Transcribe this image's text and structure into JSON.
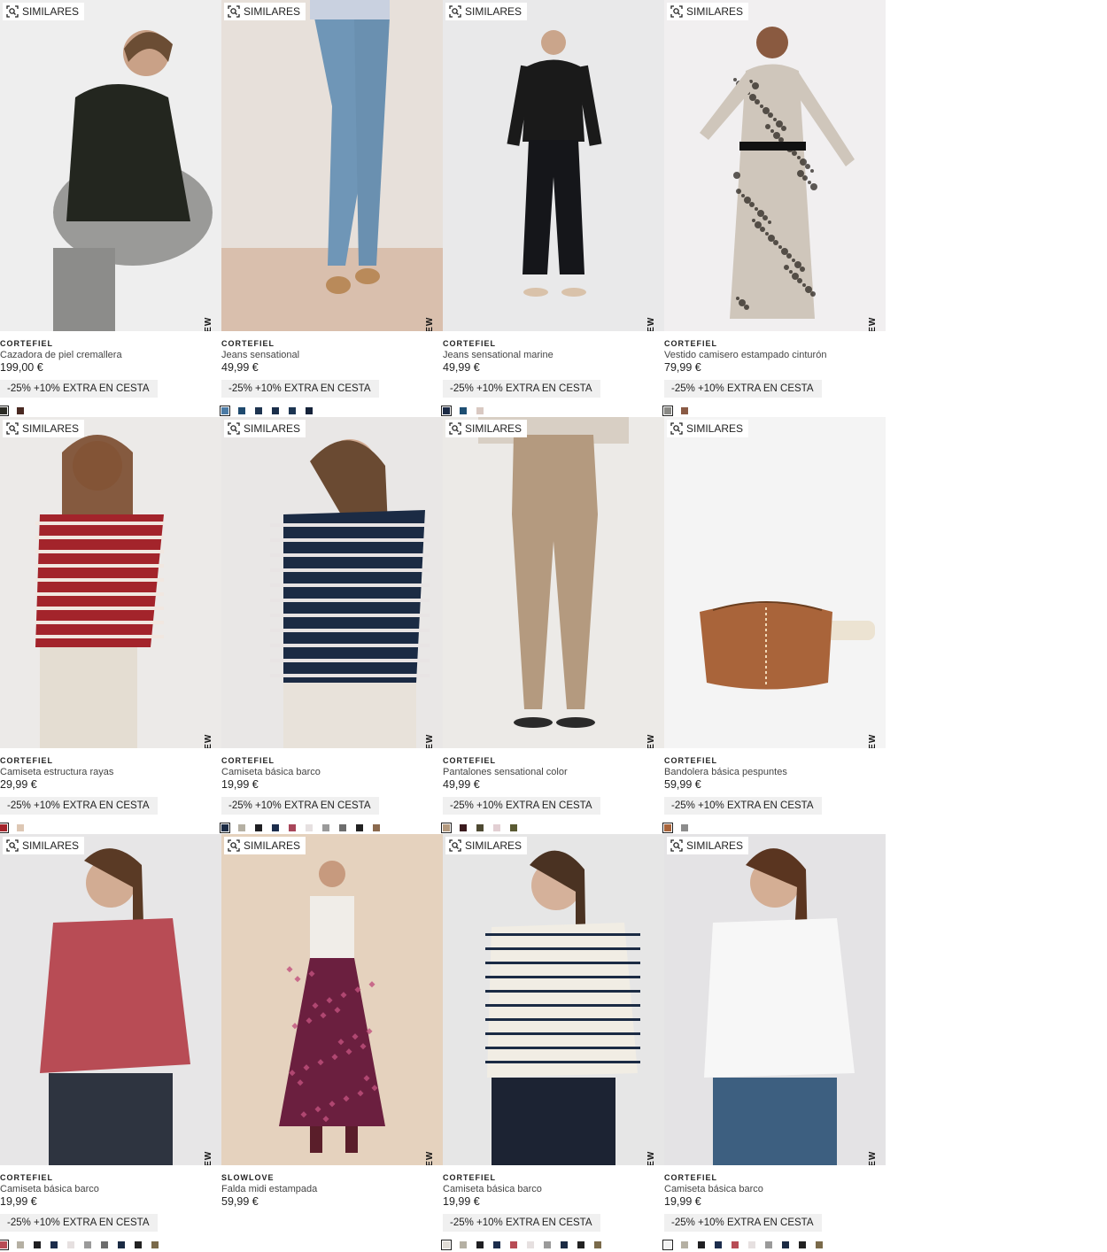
{
  "labels": {
    "similares": "SIMILARES",
    "new": "NEW"
  },
  "products": [
    {
      "brand": "CORTEFIEL",
      "name": "Cazadora de piel cremallera",
      "price": "199,00 €",
      "promo": "-25% +10% EXTRA EN CESTA",
      "new": true,
      "swatches": [
        "#2b2b24",
        "#4a2a22"
      ],
      "image": "woman-black-leather-jacket"
    },
    {
      "brand": "CORTEFIEL",
      "name": "Jeans sensational",
      "price": "49,99 €",
      "promo": "-25% +10% EXTRA EN CESTA",
      "new": true,
      "swatches": [
        "#4b7ba5",
        "#1f4a6e",
        "#1e3450",
        "#1a2e4a",
        "#1c3552",
        "#15233a"
      ],
      "image": "light-blue-skinny-jeans"
    },
    {
      "brand": "CORTEFIEL",
      "name": "Jeans sensational marine",
      "price": "49,99 €",
      "promo": "-25% +10% EXTRA EN CESTA",
      "new": true,
      "swatches": [
        "#1b2a44",
        "#1e4f73",
        "#d9c9c2"
      ],
      "image": "woman-black-outfit"
    },
    {
      "brand": "CORTEFIEL",
      "name": "Vestido camisero estampado cinturón",
      "price": "79,99 €",
      "promo": "-25% +10% EXTRA EN CESTA",
      "new": true,
      "swatches": [
        "#8a8a86",
        "#8a5a44"
      ],
      "image": "printed-shirt-dress"
    },
    {
      "brand": "CORTEFIEL",
      "name": "Camiseta estructura rayas",
      "price": "29,99 €",
      "promo": "-25% +10% EXTRA EN CESTA",
      "new": true,
      "swatches": [
        "#a3242b",
        "#ddc7b4"
      ],
      "image": "red-striped-top"
    },
    {
      "brand": "CORTEFIEL",
      "name": "Camiseta básica barco",
      "price": "19,99 €",
      "promo": "-25% +10% EXTRA EN CESTA",
      "new": true,
      "swatches": [
        "#1b2b44",
        "#b5b0a3",
        "#1f1f22",
        "#1c2d4c",
        "#a8465a",
        "#e6e0e0",
        "#9a9a9a",
        "#6d6d6d",
        "#222",
        "#8b6a4e"
      ],
      "image": "navy-striped-tee"
    },
    {
      "brand": "CORTEFIEL",
      "name": "Pantalones sensational color",
      "price": "49,99 €",
      "promo": "-25% +10% EXTRA EN CESTA",
      "new": true,
      "swatches": [
        "#b49a7f",
        "#3b1a1e",
        "#4e4a32",
        "#e2cfd3",
        "#5a5a32"
      ],
      "image": "beige-trousers"
    },
    {
      "brand": "CORTEFIEL",
      "name": "Bandolera básica pespuntes",
      "price": "59,99 €",
      "promo": "-25% +10% EXTRA EN CESTA",
      "new": true,
      "swatches": [
        "#a9643a",
        "#8c8c8c"
      ],
      "image": "brown-crossbody-bag"
    },
    {
      "brand": "CORTEFIEL",
      "name": "Camiseta básica barco",
      "price": "19,99 €",
      "promo": "-25% +10% EXTRA EN CESTA",
      "new": true,
      "swatches": [
        "#b84c55",
        "#b5b0a3",
        "#1f1f22",
        "#1c2d4c",
        "#e6e0e0",
        "#9a9a9a",
        "#6d6d6d",
        "#1b2b44",
        "#222",
        "#7a6a4a"
      ],
      "image": "pink-boat-neck-tee"
    },
    {
      "brand": "SLOWLOVE",
      "name": "Falda midi estampada",
      "price": "59,99 €",
      "promo": "",
      "new": true,
      "swatches": [],
      "image": "printed-midi-skirt"
    },
    {
      "brand": "CORTEFIEL",
      "name": "Camiseta básica barco",
      "price": "19,99 €",
      "promo": "-25% +10% EXTRA EN CESTA",
      "new": true,
      "swatches": [
        "#e0dcd6",
        "#b5b0a3",
        "#1f1f22",
        "#1c2d4c",
        "#b84c55",
        "#e6e0e0",
        "#9a9a9a",
        "#1b2b44",
        "#222",
        "#7a6a4a"
      ],
      "image": "white-navy-striped-tee"
    },
    {
      "brand": "CORTEFIEL",
      "name": "Camiseta básica barco",
      "price": "19,99 €",
      "promo": "-25% +10% EXTRA EN CESTA",
      "new": true,
      "swatches": [
        "#f2f2f2",
        "#b5b0a3",
        "#1f1f22",
        "#1c2d4c",
        "#b84c55",
        "#e6e0e0",
        "#9a9a9a",
        "#1b2b44",
        "#222",
        "#7a6a4a"
      ],
      "image": "white-boat-neck-tee"
    }
  ]
}
